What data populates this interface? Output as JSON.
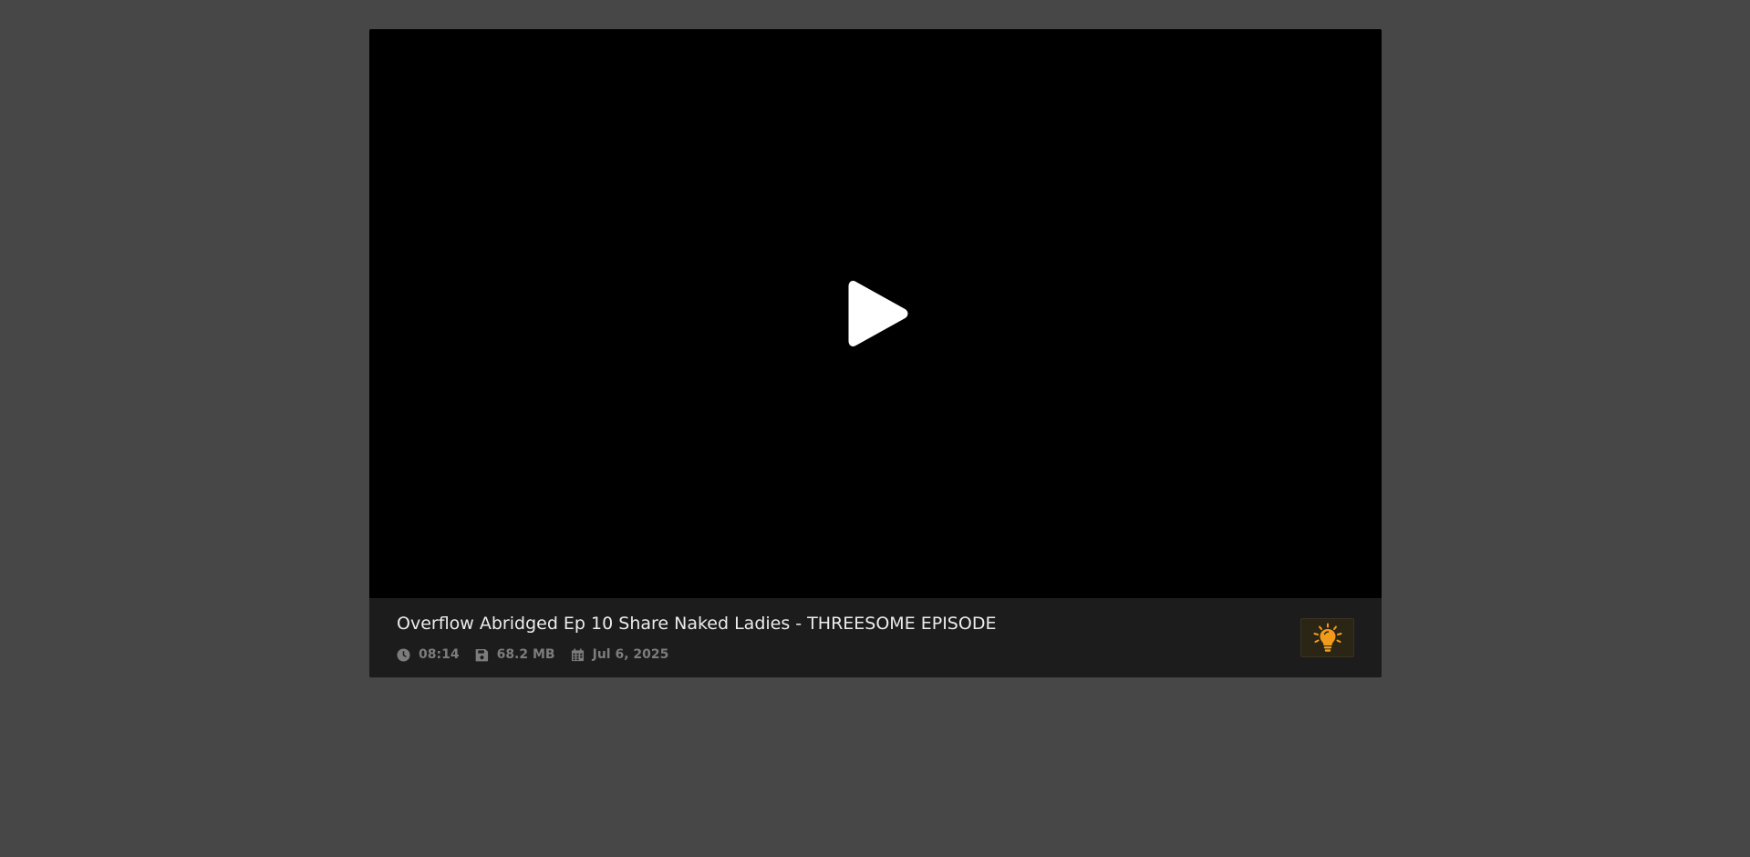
{
  "video": {
    "title": "Overflow Abridged Ep 10 Share Naked Ladies - THREESOME EPISODE",
    "duration": "08:14",
    "file_size": "68.2 MB",
    "date": "Jul 6, 2025"
  },
  "icons": {
    "play": "play-icon",
    "duration": "clock-icon",
    "file_size": "save-disk-icon",
    "date": "calendar-icon",
    "lights": "lightbulb-icon"
  },
  "colors": {
    "page_background": "#464746",
    "video_background": "#000000",
    "info_bar_background": "#1c1c1c",
    "title_text": "#ececec",
    "meta_text": "#7c7c7c",
    "lightbulb_accent": "#f29a1a"
  }
}
